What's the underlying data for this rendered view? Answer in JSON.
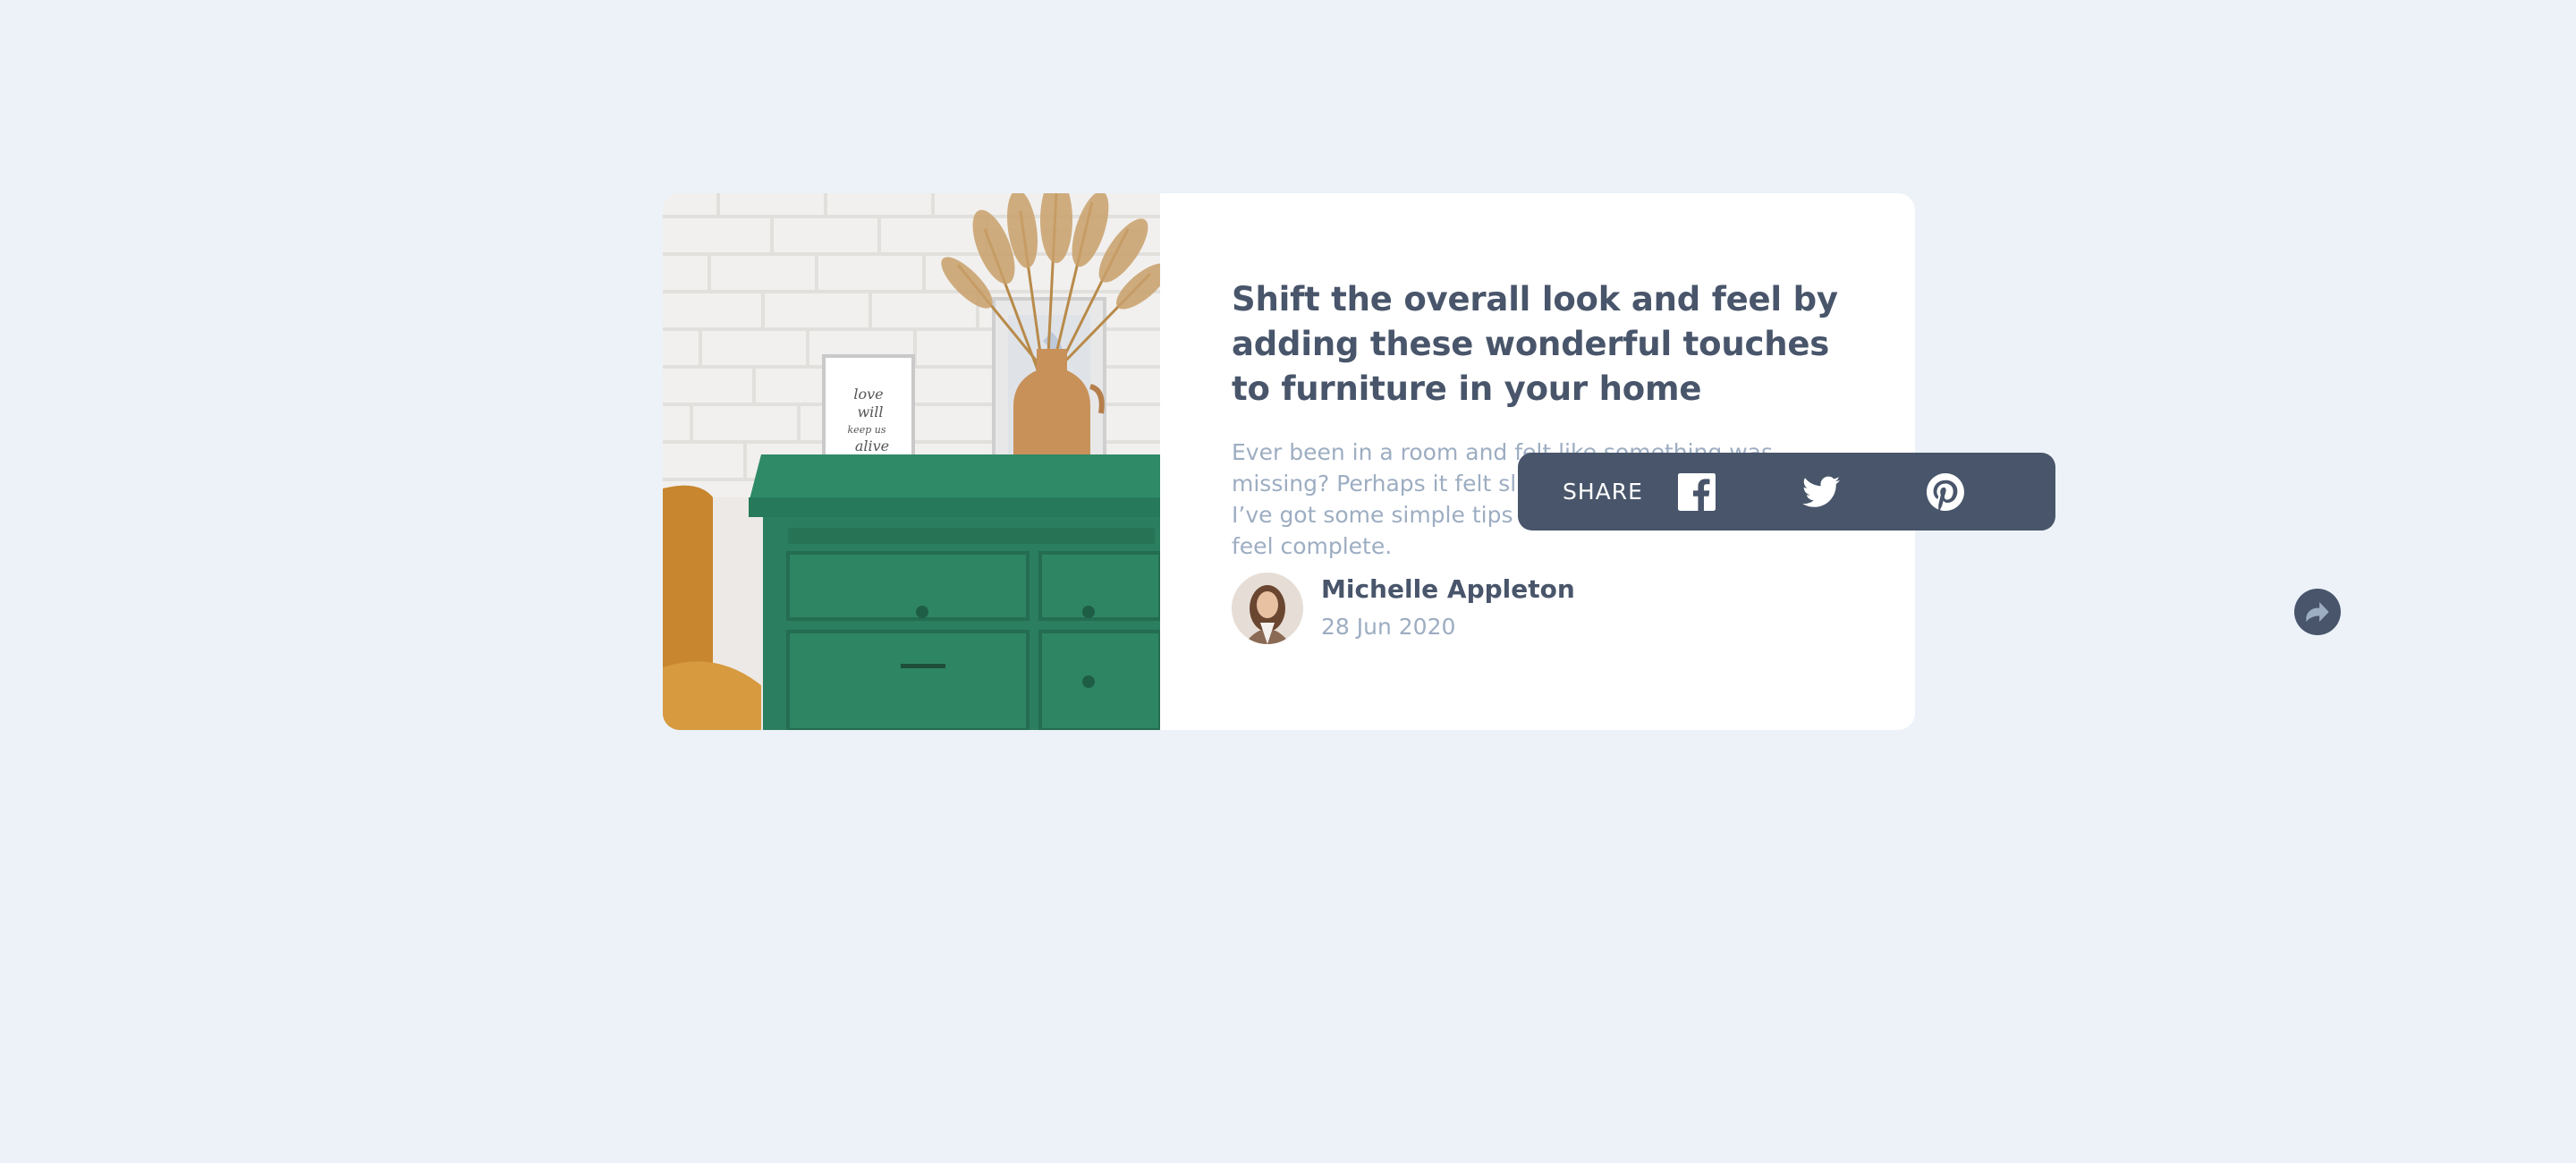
{
  "article": {
    "title": "Shift the overall look and feel by adding these wonderful touches to furniture in your home",
    "description": "Ever been in a room and felt like something was missing? Perhaps it felt slightly bare and uninviting. I’ve got some simple tips to help you make any room feel complete.",
    "author_name": "Michelle Appleton",
    "date": "28 Jun 2020"
  },
  "share": {
    "label": "SHARE",
    "networks": [
      "facebook",
      "twitter",
      "pinterest"
    ]
  },
  "colors": {
    "background": "#ecf2f8",
    "card": "#ffffff",
    "dark": "#48556a",
    "muted": "#9dadc2"
  }
}
